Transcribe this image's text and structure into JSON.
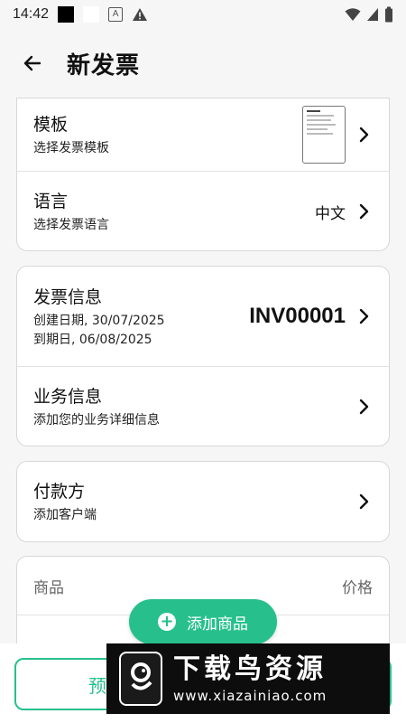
{
  "status_bar": {
    "time": "14:42",
    "letter_icon": "A"
  },
  "app_bar": {
    "title": "新发票"
  },
  "template_row": {
    "title": "模板",
    "subtitle": "选择发票模板"
  },
  "language_row": {
    "title": "语言",
    "subtitle": "选择发票语言",
    "value": "中文"
  },
  "invoice_info_row": {
    "title": "发票信息",
    "created": "创建日期, 30/07/2025",
    "due": "到期日, 06/08/2025",
    "number": "INV00001"
  },
  "business_row": {
    "title": "业务信息",
    "subtitle": "添加您的业务详细信息"
  },
  "payer_row": {
    "title": "付款方",
    "subtitle": "添加客户端"
  },
  "goods": {
    "header_label": "商品",
    "price_label": "价格",
    "add_label": "添加商品"
  },
  "bottom": {
    "preview_label": "预"
  },
  "watermark": {
    "title": "下载鸟资源",
    "url": "www.xiazainiao.com"
  },
  "colors": {
    "accent": "#27c08d"
  }
}
